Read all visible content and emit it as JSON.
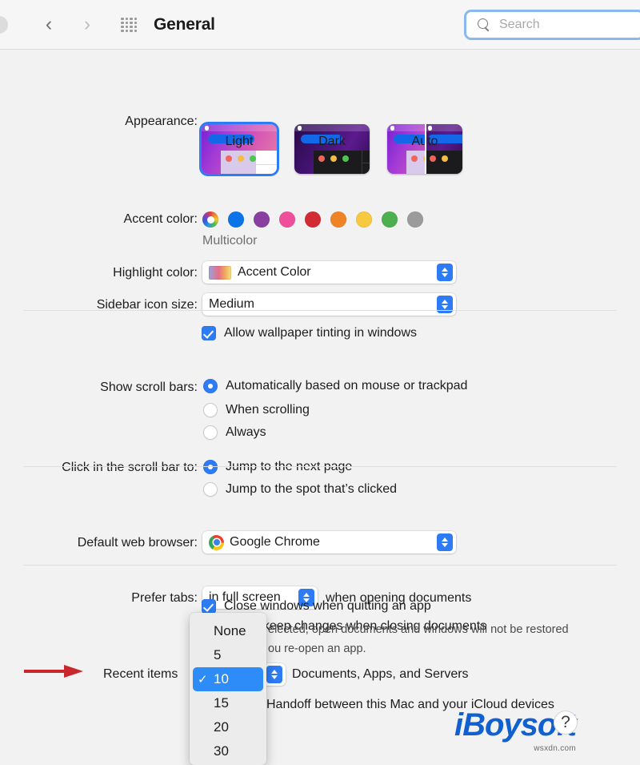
{
  "toolbar": {
    "title": "General",
    "back_icon": "chevron-left-icon",
    "forward_icon": "chevron-right-icon",
    "grid_icon": "grid-apps-icon",
    "search_placeholder": "Search",
    "search_value": ""
  },
  "appearance": {
    "label": "Appearance:",
    "options": [
      {
        "caption": "Light",
        "selected": true
      },
      {
        "caption": "Dark",
        "selected": false
      },
      {
        "caption": "Auto",
        "selected": false
      }
    ]
  },
  "accent": {
    "label": "Accent color:",
    "caption": "Multicolor",
    "swatches": [
      {
        "name": "multicolor",
        "color": "multicolor",
        "selected": true
      },
      {
        "name": "blue",
        "color": "#0a74e8"
      },
      {
        "name": "purple",
        "color": "#8a3fa0"
      },
      {
        "name": "pink",
        "color": "#ef4f9a"
      },
      {
        "name": "red",
        "color": "#d22b33"
      },
      {
        "name": "orange",
        "color": "#ef8426"
      },
      {
        "name": "yellow",
        "color": "#f7c93f"
      },
      {
        "name": "green",
        "color": "#4cb050"
      },
      {
        "name": "graphite",
        "color": "#9b9b9b"
      }
    ]
  },
  "highlight": {
    "label": "Highlight color:",
    "value": "Accent Color"
  },
  "sidebar_icon_size": {
    "label": "Sidebar icon size:",
    "value": "Medium"
  },
  "wallpaper_tinting": {
    "label": "Allow wallpaper tinting in windows",
    "checked": true
  },
  "scroll_bars": {
    "label": "Show scroll bars:",
    "options": [
      {
        "label": "Automatically based on mouse or trackpad",
        "selected": true
      },
      {
        "label": "When scrolling",
        "selected": false
      },
      {
        "label": "Always",
        "selected": false
      }
    ]
  },
  "scroll_click": {
    "label": "Click in the scroll bar to:",
    "options": [
      {
        "label": "Jump to the next page",
        "selected": true
      },
      {
        "label": "Jump to the spot that’s clicked",
        "selected": false
      }
    ]
  },
  "browser": {
    "label": "Default web browser:",
    "value": "Google Chrome",
    "icon": "chrome-icon"
  },
  "prefer_tabs": {
    "label": "Prefer tabs:",
    "value": "in full screen",
    "suffix": "when opening documents"
  },
  "ask_keep_changes": {
    "label": "Ask to keep changes when closing documents",
    "checked": false
  },
  "close_windows": {
    "label": "Close windows when quitting an app",
    "checked": true,
    "description_line1": "elected, open documents and windows will not be restored",
    "description_line2": "ou re-open an app."
  },
  "recent_items": {
    "label": "Recent items",
    "suffix": "Documents, Apps, and Servers",
    "value": "10"
  },
  "handoff": {
    "label": "Handoff between this Mac and your iCloud devices"
  },
  "popup_menu": {
    "items": [
      {
        "label": "None",
        "selected": false
      },
      {
        "label": "5",
        "selected": false
      },
      {
        "label": "10",
        "selected": true
      },
      {
        "label": "15",
        "selected": false
      },
      {
        "label": "20",
        "selected": false
      },
      {
        "label": "30",
        "selected": false
      }
    ]
  },
  "annotation": {
    "arrow_color": "#c8272c"
  },
  "watermark": {
    "brand": "iBoysoft",
    "help_glyph": "?",
    "sub": "wsxdn.com"
  },
  "colors": {
    "accent_blue": "#2d7cf6",
    "window_bg": "#f2f2f2",
    "toolbar_bg": "#f6f6f6"
  }
}
